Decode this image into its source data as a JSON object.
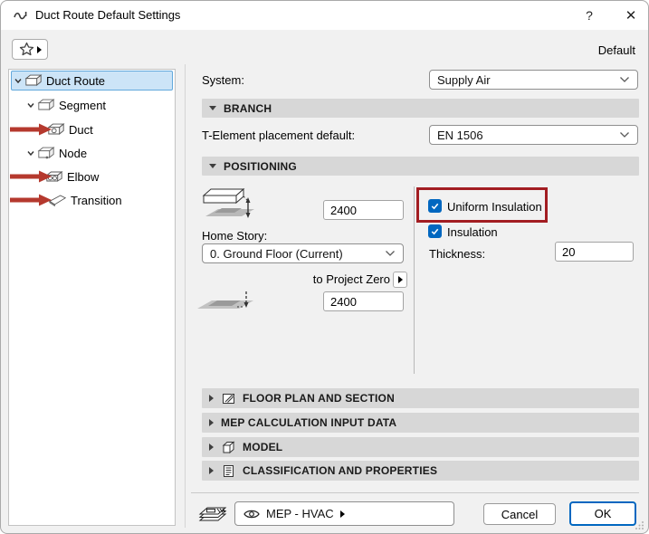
{
  "window": {
    "title": "Duct Route Default Settings",
    "help_glyph": "?",
    "close_glyph": "✕"
  },
  "toolbar": {
    "default_label": "Default"
  },
  "tree": {
    "items": [
      {
        "label": "Duct Route",
        "level": 1,
        "expanded": true,
        "selected": true,
        "icon": "duct-route-icon",
        "annotated": false
      },
      {
        "label": "Segment",
        "level": 2,
        "expanded": true,
        "selected": false,
        "icon": "segment-icon",
        "annotated": false
      },
      {
        "label": "Duct",
        "level": 3,
        "expanded": false,
        "selected": false,
        "icon": "duct-icon",
        "annotated": true
      },
      {
        "label": "Node",
        "level": 2,
        "expanded": true,
        "selected": false,
        "icon": "node-icon",
        "annotated": false
      },
      {
        "label": "Elbow",
        "level": 3,
        "expanded": false,
        "selected": false,
        "icon": "elbow-icon",
        "annotated": true
      },
      {
        "label": "Transition",
        "level": 3,
        "expanded": false,
        "selected": false,
        "icon": "transition-icon",
        "annotated": true
      }
    ]
  },
  "system": {
    "label": "System:",
    "value": "Supply Air"
  },
  "branch": {
    "title": "BRANCH",
    "t_element_label": "T-Element placement default:",
    "t_element_value": "EN 1506"
  },
  "positioning": {
    "title": "POSITIONING",
    "top_elevation": "2400",
    "home_story_label": "Home Story:",
    "home_story_value": "0. Ground Floor (Current)",
    "to_project_zero_label": "to Project Zero",
    "bottom_elevation": "2400",
    "uniform_insulation_label": "Uniform Insulation",
    "uniform_insulation_checked": true,
    "insulation_label": "Insulation",
    "insulation_checked": true,
    "thickness_label": "Thickness:",
    "thickness_value": "20"
  },
  "collapsed_sections": [
    {
      "title": "FLOOR PLAN AND SECTION",
      "icon": "floor-plan-icon"
    },
    {
      "title": "MEP CALCULATION INPUT DATA",
      "icon": null
    },
    {
      "title": "MODEL",
      "icon": "model-icon"
    },
    {
      "title": "CLASSIFICATION AND PROPERTIES",
      "icon": "classification-icon"
    }
  ],
  "footer": {
    "layer_value": "MEP - HVAC",
    "cancel_label": "Cancel",
    "ok_label": "OK"
  },
  "colors": {
    "accent": "#0067c0",
    "selection_bg": "#cce4f7",
    "selection_border": "#62a8dc",
    "annotation_arrow_red": "#b5392e",
    "annotation_box_red": "#a21d22",
    "section_header_bg": "#d7d7d7"
  }
}
